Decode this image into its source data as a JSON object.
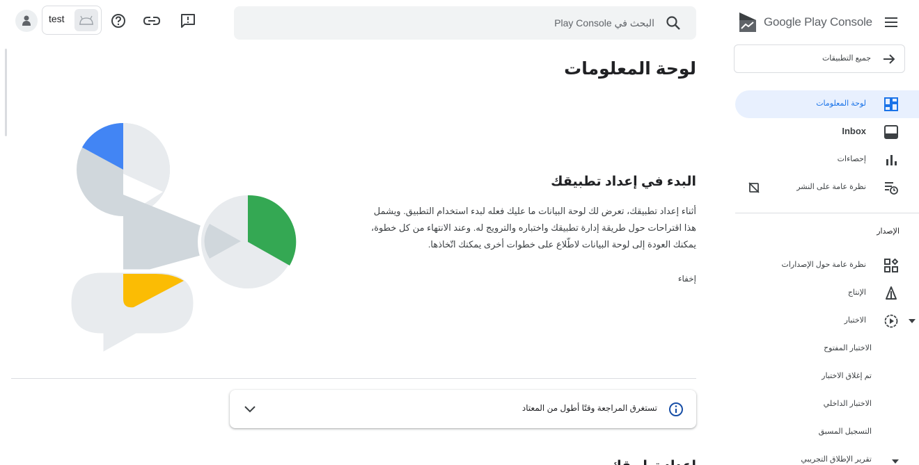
{
  "header": {
    "app_name": "test",
    "search_placeholder": "البحث في Play Console",
    "icons": [
      "user-avatar-icon",
      "android-icon",
      "help-icon",
      "link-icon",
      "feedback-icon",
      "search-icon"
    ]
  },
  "main": {
    "page_title": "لوحة المعلومات",
    "setup": {
      "heading": "البدء في إعداد تطبيقك",
      "body": "أثناء إعداد تطبيقك، تعرض لك لوحة البيانات ما عليك فعله لبدء استخدام التطبيق. ويشمل هذا اقتراحات حول طريقة إدارة تطبيقك واختباره والترويج له. وعند الانتهاء من كل خطوة، يمكنك العودة إلى لوحة البيانات لاطّلاع على خطوات أخرى يمكنك اتّخاذها.",
      "hide_label": "إخفاء"
    },
    "review_notice": {
      "text": "تستغرق المراجعة وقتًا أطول من المعتاد"
    },
    "next_heading_peek": "إعداد تطبيقك"
  },
  "sidebar": {
    "logo_text_google": "Google Play",
    "logo_text_console": "Console",
    "all_apps_label": "جميع التطبيقات",
    "items": [
      {
        "label": "لوحة المعلومات",
        "icon": "dashboard-icon",
        "active": true
      },
      {
        "label": "Inbox",
        "icon": "inbox-icon",
        "active": false
      },
      {
        "label": "إحصاءات",
        "icon": "bar-chart-icon",
        "active": false
      },
      {
        "label": "نظرة عامة على النشر",
        "icon": "publishing-overview-icon",
        "active": false
      }
    ],
    "release_section_heading": "الإصدار",
    "release_items": [
      {
        "label": "نظرة عامة حول الإصدارات",
        "icon": "releases-overview-icon"
      },
      {
        "label": "الإنتاج",
        "icon": "production-icon"
      },
      {
        "label": "الاختبار",
        "icon": "testing-icon"
      }
    ],
    "testing_subitems": [
      {
        "label": "الاختبار المفتوح"
      },
      {
        "label": "تم إغلاق الاختبار"
      },
      {
        "label": "الاختبار الداخلي"
      },
      {
        "label": "التسجيل المسبق"
      },
      {
        "label": "تقرير الإطلاق التجريبي"
      }
    ]
  },
  "colors": {
    "accent_blue": "#1a73e8",
    "active_bg": "#e8f0fe",
    "illustration_blue": "#4285f4",
    "illustration_green": "#34a853",
    "illustration_yellow": "#fbbc04",
    "illustration_gray": "#d0d7dc",
    "illustration_light": "#e8ebee"
  }
}
